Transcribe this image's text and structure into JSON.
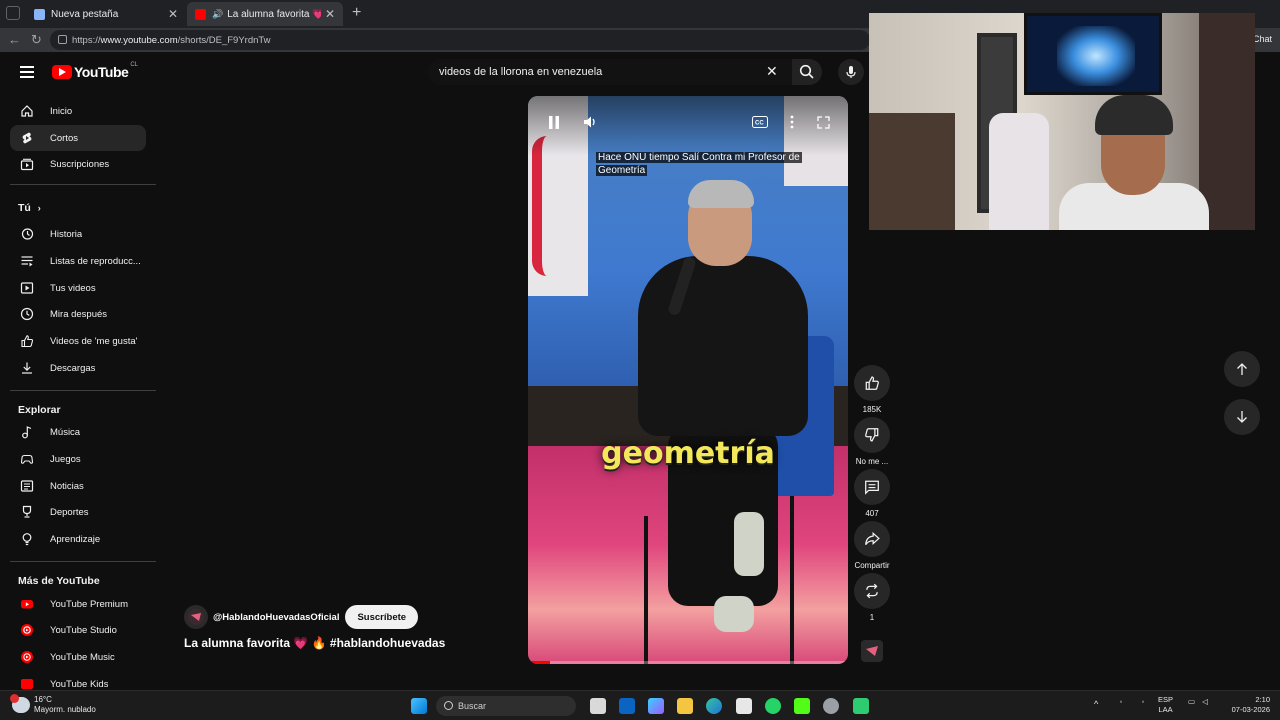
{
  "browser": {
    "tabs": [
      {
        "label": "Nueva pestaña",
        "active": false
      },
      {
        "label": "La alumna favorita 💗 🔥 #h",
        "active": true
      }
    ],
    "url_prefix": "https://",
    "url_host": "www.youtube.com",
    "url_path": "/shorts/DE_F9YrdnTw",
    "extension_label": "Chat"
  },
  "header": {
    "logo_text": "YouTube",
    "country_code": "CL",
    "search_value": "videos de la llorona en venezuela"
  },
  "sidebar": {
    "main": [
      {
        "label": "Inicio",
        "icon": "home-icon"
      },
      {
        "label": "Cortos",
        "icon": "shorts-icon",
        "active": true
      },
      {
        "label": "Suscripciones",
        "icon": "subscriptions-icon"
      }
    ],
    "you_heading": "Tú",
    "you": [
      {
        "label": "Historia",
        "icon": "history-icon"
      },
      {
        "label": "Listas de reproducc...",
        "icon": "playlist-icon"
      },
      {
        "label": "Tus videos",
        "icon": "your-videos-icon"
      },
      {
        "label": "Mira después",
        "icon": "watch-later-icon"
      },
      {
        "label": "Videos de 'me gusta'",
        "icon": "liked-icon"
      },
      {
        "label": "Descargas",
        "icon": "downloads-icon"
      }
    ],
    "explore_heading": "Explorar",
    "explore": [
      {
        "label": "Música",
        "icon": "music-icon"
      },
      {
        "label": "Juegos",
        "icon": "games-icon"
      },
      {
        "label": "Noticias",
        "icon": "news-icon"
      },
      {
        "label": "Deportes",
        "icon": "sports-icon"
      },
      {
        "label": "Aprendizaje",
        "icon": "learning-icon"
      }
    ],
    "more_heading": "Más de YouTube",
    "more": [
      {
        "label": "YouTube Premium",
        "icon": "youtube-premium-icon"
      },
      {
        "label": "YouTube Studio",
        "icon": "youtube-studio-icon"
      },
      {
        "label": "YouTube Music",
        "icon": "youtube-music-icon"
      },
      {
        "label": "YouTube Kids",
        "icon": "youtube-kids-icon"
      }
    ]
  },
  "video": {
    "overlay_title": "Hace ONU tiempo Salí Contra mi Profesor de Geometría",
    "caption": "geometría",
    "progress": 0.07
  },
  "channel": {
    "handle": "@HablandoHuevadasOficial",
    "subscribe_label": "Suscríbete"
  },
  "short_title": "La alumna favorita 💗 🔥 #hablandohuevadas",
  "actions": {
    "likes": "185K",
    "dislike_label": "No me ...",
    "comments": "407",
    "share_label": "Compartir",
    "remix_count": "1"
  },
  "taskbar": {
    "temperature": "16°C",
    "weather": "Mayorm. nublado",
    "search_label": "Buscar",
    "lang_top": "ESP",
    "lang_bottom": "LAA",
    "time": "2:10",
    "date": "07-03-2026"
  },
  "colors": {
    "youtube_red": "#ff0000",
    "caption_yellow": "#f3e85a",
    "background": "#0f0f0f"
  }
}
